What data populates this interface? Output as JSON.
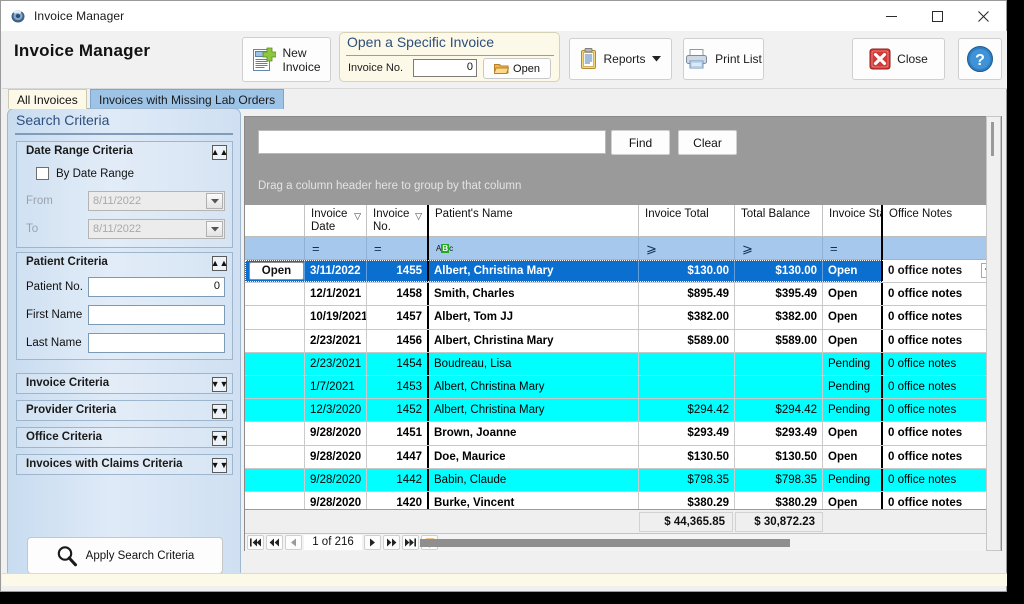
{
  "window": {
    "title": "Invoice Manager",
    "app_icon": "invoice-app-icon",
    "minimize_label": "Minimize",
    "maximize_label": "Maximize",
    "close_label": "Close"
  },
  "header": {
    "app_title": "Invoice Manager",
    "new_invoice_line1": "New",
    "new_invoice_line2": "Invoice",
    "reports_label": "Reports",
    "print_list_label": "Print List",
    "close_label": "Close",
    "help_label": "?",
    "open_group": {
      "title": "Open a Specific Invoice",
      "invoice_no_label": "Invoice No.",
      "invoice_no_value": "0",
      "open_label": "Open"
    }
  },
  "tabs": [
    {
      "label": "All Invoices",
      "active": true
    },
    {
      "label": "Invoices with Missing Lab Orders",
      "active": false
    }
  ],
  "search_panel": {
    "title": "Search Criteria",
    "date_range": {
      "heading": "Date Range Criteria",
      "checkbox_label": "By Date Range",
      "checked": false,
      "from_label": "From",
      "from_value": "8/11/2022",
      "to_label": "To",
      "to_value": "8/11/2022"
    },
    "patient": {
      "heading": "Patient Criteria",
      "patient_no_label": "Patient No.",
      "patient_no_value": "0",
      "first_name_label": "First Name",
      "first_name_value": "",
      "last_name_label": "Last Name",
      "last_name_value": ""
    },
    "collapsed_groups": [
      {
        "heading": "Invoice Criteria"
      },
      {
        "heading": "Provider Criteria"
      },
      {
        "heading": "Office Criteria"
      },
      {
        "heading": "Invoices with Claims Criteria"
      }
    ],
    "apply_label": "Apply Search Criteria"
  },
  "grid": {
    "search_value": "",
    "search_placeholder": "",
    "find_label": "Find",
    "clear_label": "Clear",
    "group_hint": "Drag a column header here to group by that column",
    "columns": [
      {
        "label": "",
        "key": "open"
      },
      {
        "label": "Invoice Date",
        "key": "date",
        "filter": "="
      },
      {
        "label": "Invoice No.",
        "key": "no",
        "filter": "="
      },
      {
        "label": "Patient's Name",
        "key": "patient",
        "filter": "abc"
      },
      {
        "label": "Invoice Total",
        "key": "total",
        "filter": ">"
      },
      {
        "label": "Total Balance",
        "key": "balance",
        "filter": ">"
      },
      {
        "label": "Invoice Status",
        "key": "status",
        "filter": "="
      },
      {
        "label": "Office Notes",
        "key": "notes",
        "filter": ""
      }
    ],
    "rows": [
      {
        "open": "Open",
        "date": "3/11/2022",
        "no": "1455",
        "patient": "Albert, Christina Mary",
        "total": "$130.00",
        "balance": "$130.00",
        "status": "Open",
        "notes": "0 office notes",
        "state": "selected"
      },
      {
        "open": "",
        "date": "12/1/2021",
        "no": "1458",
        "patient": "Smith, Charles",
        "total": "$895.49",
        "balance": "$395.49",
        "status": "Open",
        "notes": "0 office notes",
        "state": "normal"
      },
      {
        "open": "",
        "date": "10/19/2021",
        "no": "1457",
        "patient": "Albert, Tom JJ",
        "total": "$382.00",
        "balance": "$382.00",
        "status": "Open",
        "notes": "0 office notes",
        "state": "normal"
      },
      {
        "open": "",
        "date": "2/23/2021",
        "no": "1456",
        "patient": "Albert, Christina Mary",
        "total": "$589.00",
        "balance": "$589.00",
        "status": "Open",
        "notes": "0 office notes",
        "state": "normal"
      },
      {
        "open": "",
        "date": "2/23/2021",
        "no": "1454",
        "patient": "Boudreau, Lisa",
        "total": "",
        "balance": "",
        "status": "Pending",
        "notes": "0 office notes",
        "state": "pending"
      },
      {
        "open": "",
        "date": "1/7/2021",
        "no": "1453",
        "patient": "Albert, Christina Mary",
        "total": "",
        "balance": "",
        "status": "Pending",
        "notes": "0 office notes",
        "state": "pending"
      },
      {
        "open": "",
        "date": "12/3/2020",
        "no": "1452",
        "patient": "Albert, Christina Mary",
        "total": "$294.42",
        "balance": "$294.42",
        "status": "Pending",
        "notes": "0 office notes",
        "state": "pending"
      },
      {
        "open": "",
        "date": "9/28/2020",
        "no": "1451",
        "patient": "Brown, Joanne",
        "total": "$293.49",
        "balance": "$293.49",
        "status": "Open",
        "notes": "0 office notes",
        "state": "normal"
      },
      {
        "open": "",
        "date": "9/28/2020",
        "no": "1447",
        "patient": "Doe, Maurice",
        "total": "$130.50",
        "balance": "$130.50",
        "status": "Open",
        "notes": "0 office notes",
        "state": "normal"
      },
      {
        "open": "",
        "date": "9/28/2020",
        "no": "1442",
        "patient": "Babin, Claude",
        "total": "$798.35",
        "balance": "$798.35",
        "status": "Pending",
        "notes": "0 office notes",
        "state": "pending"
      },
      {
        "open": "",
        "date": "9/28/2020",
        "no": "1420",
        "patient": "Burke, Vincent",
        "total": "$380.29",
        "balance": "$380.29",
        "status": "Open",
        "notes": "0 office notes",
        "state": "normal"
      }
    ],
    "totals": {
      "invoice_total": "$ 44,365.85",
      "total_balance": "$ 30,872.23"
    },
    "pager": {
      "first_label": "First page",
      "prev_page_label": "Previous page",
      "prev_label": "Previous",
      "page_text": "1 of 216",
      "next_label": "Next",
      "next_page_label": "Next page",
      "last_label": "Last page",
      "filter_label": "Filter editor"
    }
  },
  "colors": {
    "selected_row": "#0b6fd0",
    "pending_row": "#00ffff",
    "filter_row": "#a5c8ec",
    "grid_top": "#9a9a9a",
    "panel_gradient_start": "#c8dcf0",
    "tab_inactive": "#9dc3e6",
    "group_title": "#2d4f7c"
  }
}
